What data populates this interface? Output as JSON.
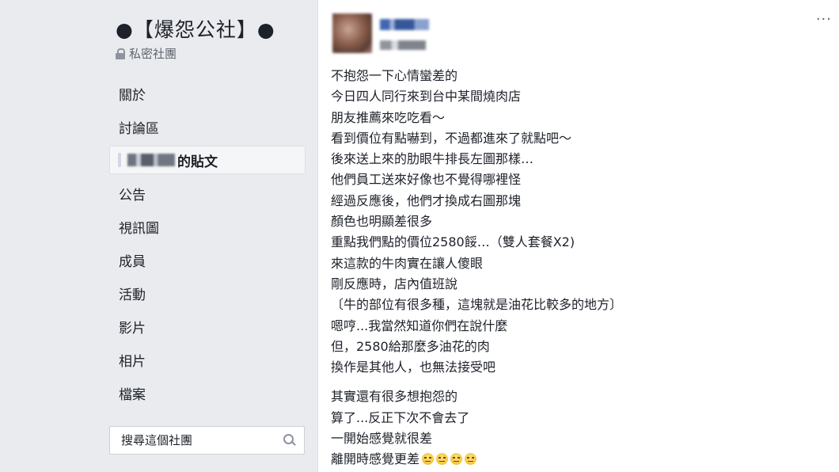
{
  "sidebar": {
    "group_title": "●【爆怨公社】●",
    "privacy_label": "私密社團",
    "nav_items": [
      {
        "label": "關於"
      },
      {
        "label": "討論區"
      },
      {
        "label": "的貼文"
      },
      {
        "label": "公告"
      },
      {
        "label": "視訊圖"
      },
      {
        "label": "成員"
      },
      {
        "label": "活動"
      },
      {
        "label": "影片"
      },
      {
        "label": "相片"
      },
      {
        "label": "檔案"
      }
    ],
    "search_placeholder": "搜尋這個社團"
  },
  "post": {
    "more_label": "···",
    "lines": [
      "不抱怨一下心情蠻差的",
      "今日四人同行來到台中某間燒肉店",
      "朋友推薦來吃吃看～",
      "看到價位有點嚇到，不過都進來了就點吧～",
      "後來送上來的肋眼牛排長左圖那樣…",
      "他們員工送來好像也不覺得哪裡怪",
      "經過反應後，他們才換成右圖那塊",
      "顏色也明顯差很多",
      "重點我們點的價位2580餒…（雙人套餐X2)",
      "來這款的牛肉實在讓人傻眼",
      "剛反應時，店內值班說",
      "〔牛的部位有很多種，這塊就是油花比較多的地方〕",
      "嗯哼...我當然知道你們在說什麼",
      "但，2580給那麼多油花的肉",
      "換作是其他人，也無法接受吧"
    ],
    "lines2": [
      "其實還有很多想抱怨的",
      "算了...反正下次不會去了",
      "一開始感覺就很差",
      "離開時感覺更差"
    ],
    "emoji_icons": [
      "expressionless-face-icon",
      "expressionless-face-icon",
      "expressionless-face-icon",
      "expressionless-face-icon"
    ]
  },
  "colors": {
    "page_bg": "#e9ebee",
    "card_bg": "#ffffff",
    "text": "#1d2129",
    "muted": "#606770"
  }
}
